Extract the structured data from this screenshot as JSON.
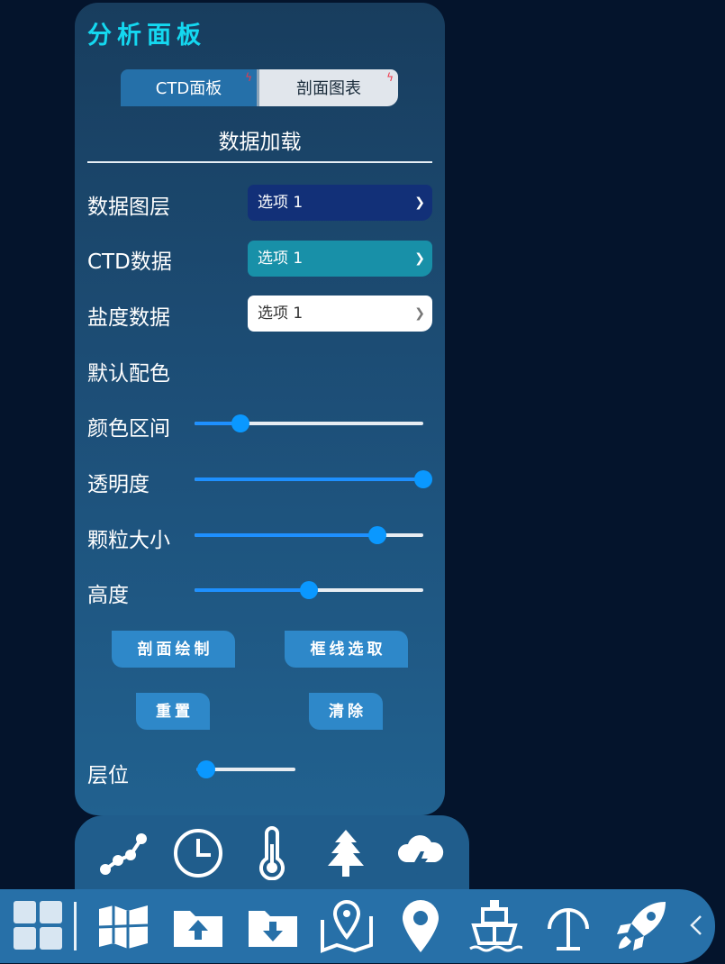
{
  "panel": {
    "title": "分析面板",
    "tabs": [
      {
        "label": "CTD面板"
      },
      {
        "label": "剖面图表"
      }
    ],
    "section_title": "数据加载"
  },
  "fields": {
    "data_layer": {
      "label": "数据图层",
      "value": "选项 1"
    },
    "ctd_data": {
      "label": "CTD数据",
      "value": "选项 1"
    },
    "salinity_data": {
      "label": "盐度数据",
      "value": "选项 1"
    },
    "default_colors": {
      "label": "默认配色"
    }
  },
  "sliders": {
    "color_range": {
      "label": "颜色区间",
      "value": 0.2
    },
    "opacity": {
      "label": "透明度",
      "value": 1.0
    },
    "particle_size": {
      "label": "颗粒大小",
      "value": 0.8
    },
    "height": {
      "label": "高度",
      "value": 0.5
    },
    "layer": {
      "label": "层位",
      "value": 0.1
    }
  },
  "buttons": {
    "profile_draw": "剖面绘制",
    "box_select": "框线选取",
    "reset": "重置",
    "clear": "清除"
  },
  "tools": [
    "line-chart-icon",
    "clock-icon",
    "thermometer-icon",
    "tree-icon",
    "storm-cloud-icon"
  ],
  "bottom_bar": [
    "grid-icon",
    "map-icon",
    "folder-upload-icon",
    "folder-download-icon",
    "map-pin-icon",
    "location-pin-icon",
    "ship-icon",
    "antenna-icon",
    "rocket-icon",
    "collapse-chevron-icon"
  ],
  "colors": {
    "title": "#14d8f0",
    "accent": "#1e90ff",
    "panel": "#1d4f78",
    "bottom_bar": "#2770a8"
  }
}
